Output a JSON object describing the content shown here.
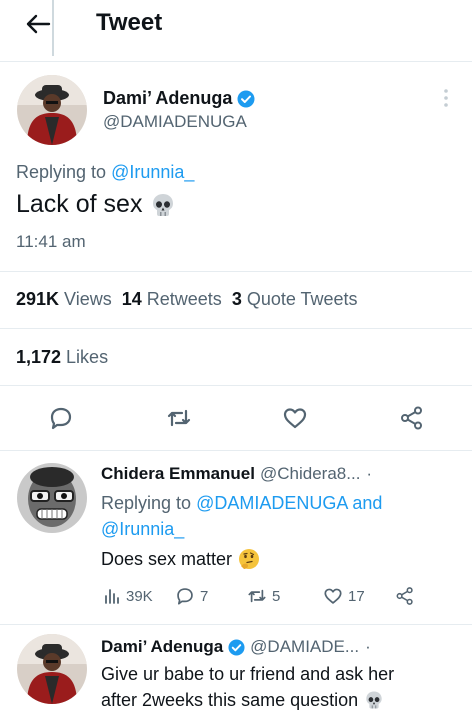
{
  "header": {
    "title": "Tweet"
  },
  "main_tweet": {
    "name": "Dami’ Adenuga",
    "handle": "@DAMIADENUGA",
    "replying_prefix": "Replying to",
    "replying_to": "@Irunnia_",
    "text": "Lack of sex",
    "emoji": "skull-emoji",
    "time": "11:41 am",
    "views_count": "291K",
    "views_label": "Views",
    "retweets_count": "14",
    "retweets_label": "Retweets",
    "quotes_count": "3",
    "quotes_label": "Quote Tweets",
    "likes_count": "1,172",
    "likes_label": "Likes"
  },
  "reply1": {
    "name": "Chidera Emmanuel",
    "handle": "@Chidera8...",
    "dot": "·",
    "replying_prefix": "Replying to",
    "replying_to_1": "@DAMIADENUGA",
    "and": "and",
    "replying_to_2": "@Irunnia_",
    "text": "Does sex matter",
    "emoji": "thinking-face-emoji",
    "views": "39K",
    "replies": "7",
    "retweets": "5",
    "likes": "17"
  },
  "reply2": {
    "name": "Dami’ Adenuga",
    "handle": "@DAMIADE...",
    "dot": "·",
    "line1": "Give ur babe to ur friend and ask her",
    "line2": "after 2weeks this same question",
    "emoji": "skull-emoji"
  },
  "colors": {
    "accent": "#1d9bf0",
    "text_primary": "#0f1419",
    "text_secondary": "#536471",
    "divider": "#e6ecf0",
    "verified": "#1d9bf0"
  }
}
